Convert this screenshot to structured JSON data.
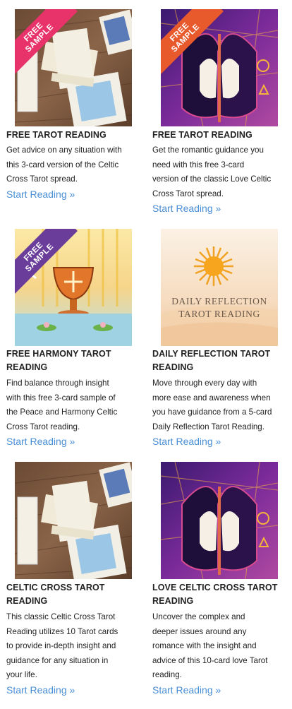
{
  "cards": [
    {
      "ribbon": [
        "FREE",
        "SAMPLE"
      ],
      "ribbon_color": "#e8326a",
      "image": "celtic-cross-table-image",
      "title": [
        "FREE TAROT READING"
      ],
      "desc": [
        "Get advice on any situation with",
        "this 3-card version of the Celtic",
        "Cross Tarot spread."
      ],
      "cta": "Start Reading »"
    },
    {
      "ribbon": [
        "FREE",
        "SAMPLE"
      ],
      "ribbon_color": "#e8592c",
      "image": "love-couple-image",
      "title": [
        "FREE TAROT READING"
      ],
      "desc": [
        "Get the romantic guidance you",
        "need with this free 3-card",
        "version of the classic Love Celtic",
        "Cross Tarot spread."
      ],
      "cta": "Start Reading »"
    },
    {
      "ribbon": [
        "FREE",
        "SAMPLE"
      ],
      "ribbon_color": "#6a3d9a",
      "image": "harmony-chalice-image",
      "title": [
        "FREE HARMONY TAROT",
        "READING"
      ],
      "desc": [
        "Find balance through insight",
        "with this free 3-card sample of",
        "the Peace and Harmony Celtic",
        "Cross Tarot reading."
      ],
      "cta": "Start Reading »"
    },
    {
      "image": "daily-reflection-image",
      "image_text": [
        "DAILY REFLECTION",
        "TAROT READING"
      ],
      "title": [
        "DAILY REFLECTION TAROT",
        "READING"
      ],
      "desc": [
        "Move through every day with",
        "more ease and awareness when",
        "you have guidance from a 5-card",
        "Daily Reflection Tarot Reading."
      ],
      "cta": "Start Reading »"
    },
    {
      "image": "celtic-cross-table-image",
      "title": [
        "CELTIC CROSS TAROT",
        "READING"
      ],
      "desc": [
        "This classic Celtic Cross Tarot",
        "Reading utilizes 10 Tarot cards",
        "to provide in-depth insight and",
        "guidance for any situation in",
        "your life."
      ],
      "cta": "Start Reading »"
    },
    {
      "image": "love-couple-image",
      "title": [
        "LOVE CELTIC CROSS TAROT",
        "READING"
      ],
      "desc": [
        "Uncover the complex and",
        "deeper issues around any",
        "romance with the insight and",
        "advice of this 10-card love Tarot",
        "reading."
      ],
      "cta": "Start Reading »"
    }
  ],
  "colors": {
    "link": "#4a8fd6",
    "text": "#222222"
  }
}
